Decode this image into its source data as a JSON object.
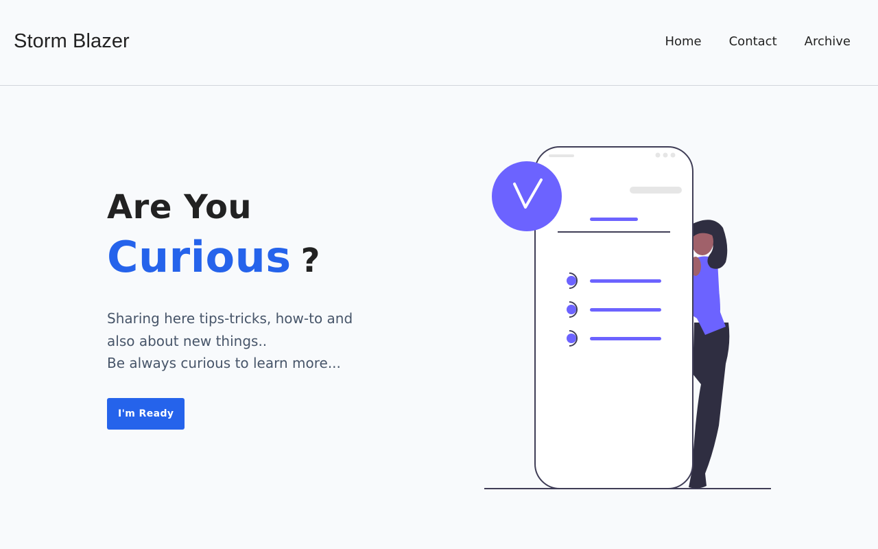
{
  "header": {
    "brand": "Storm Blazer",
    "nav": [
      {
        "label": "Home"
      },
      {
        "label": "Contact"
      },
      {
        "label": "Archive"
      }
    ]
  },
  "hero": {
    "title_line1": "Are You",
    "title_accent": "Curious",
    "title_question": "?",
    "lead_lines": [
      "Sharing here tips-tricks, how-to and",
      "also about new things..",
      "Be always curious to learn more..."
    ],
    "cta_label": "I'm Ready"
  },
  "illustration": {
    "icon": "checkmark-icon",
    "colors": {
      "accent": "#6c63ff",
      "skin": "#a0616a",
      "hair": "#2f2e41",
      "outline": "#3f3d56"
    }
  },
  "colors": {
    "brand_blue": "#2563eb",
    "background": "#f8fafc",
    "heading": "#222222",
    "body_text": "#475569"
  }
}
